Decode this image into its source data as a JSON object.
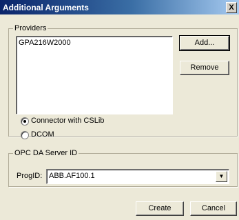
{
  "window": {
    "title": "Additional Arguments",
    "close_glyph": "X"
  },
  "providers": {
    "legend": "Providers",
    "items": [
      "GPA216W2000"
    ],
    "add_label": "Add...",
    "remove_label": "Remove",
    "options": [
      {
        "label": "Connector with CSLib",
        "selected": true
      },
      {
        "label": "DCOM",
        "selected": false
      }
    ]
  },
  "server": {
    "legend": "OPC DA Server ID",
    "progid_label": "ProgID:",
    "progid_value": "ABB.AF100.1",
    "dropdown_glyph": "▼"
  },
  "footer": {
    "create_label": "Create",
    "cancel_label": "Cancel"
  }
}
